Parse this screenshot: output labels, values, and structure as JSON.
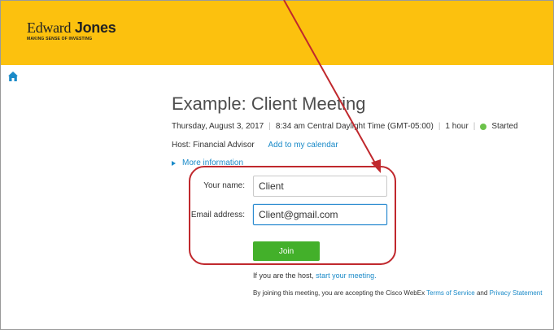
{
  "brand": {
    "logo_word1": "Edward",
    "logo_word2": "Jones",
    "tagline": "MAKING SENSE OF INVESTING",
    "header_color": "#fcc10e"
  },
  "nav": {
    "home_icon": "home-icon"
  },
  "meeting": {
    "title": "Example: Client Meeting",
    "date": "Thursday, August 3, 2017",
    "time": "8:34 am Central Daylight Time (GMT-05:00)",
    "duration": "1 hour",
    "status": "Started",
    "status_color": "#6cc24a",
    "host_label": "Host: Financial Advisor",
    "add_calendar": "Add to my calendar",
    "more_info": "More information"
  },
  "form": {
    "name_label": "Your name:",
    "name_value": "Client",
    "email_label": "Email address:",
    "email_value": "Client@gmail.com",
    "join_label": "Join",
    "join_color": "#43b02a"
  },
  "footer": {
    "host_prefix": "If you are the host,",
    "host_link": "start your meeting.",
    "terms_prefix": "By joining this meeting, you are accepting the Cisco WebEx",
    "terms_link": "Terms of Service",
    "terms_and": "and",
    "privacy_link": "Privacy Statement"
  },
  "annotation_color": "#c0282d"
}
